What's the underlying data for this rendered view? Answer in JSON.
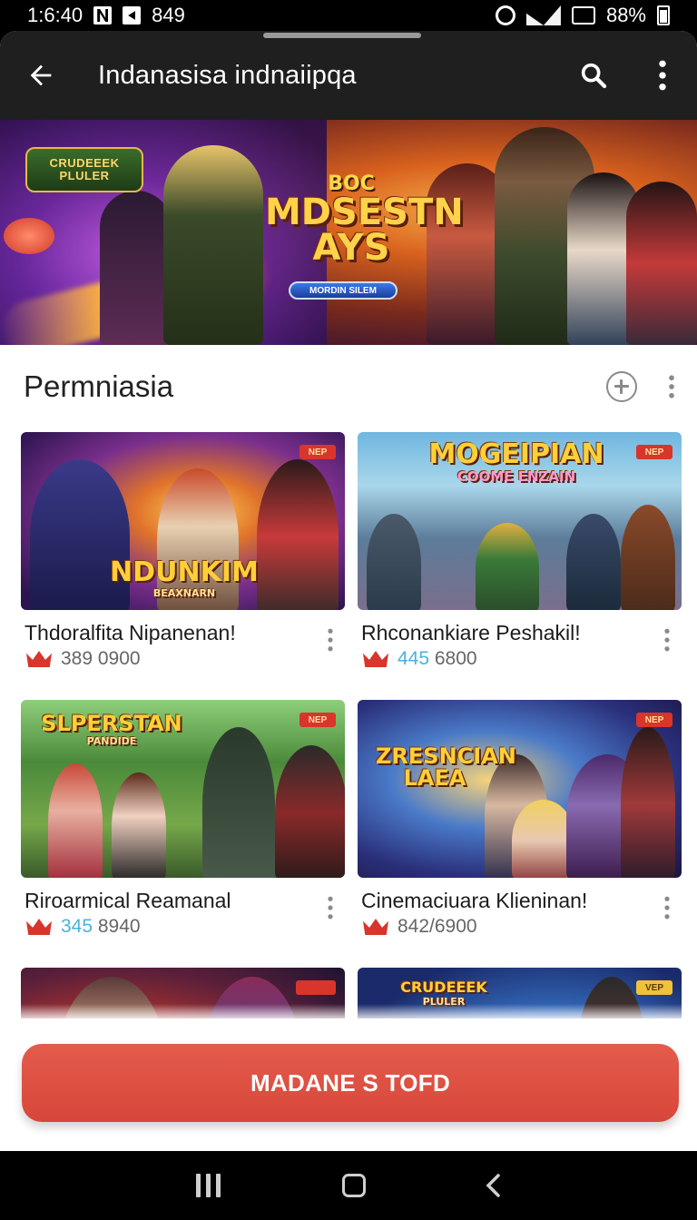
{
  "status_bar": {
    "time": "1:6:40",
    "notification_count": "849",
    "battery": "88%",
    "icons": [
      "n-icon",
      "box-icon",
      "alarm-icon",
      "wifi-icon",
      "battery-saver-icon",
      "battery-icon"
    ]
  },
  "app_bar": {
    "title": "Indanasisa indnaiipqa",
    "back_icon": "arrow-left-icon",
    "search_icon": "search-icon",
    "more_icon": "more-vertical-icon"
  },
  "banner": {
    "logo_line1": "CRUDEEEK",
    "logo_line2": "PLULER",
    "supertitle": "BOC",
    "title": "MDSESTN\nAYS",
    "pill": "MORDIN SILEM"
  },
  "section": {
    "title": "Permniasia",
    "add_icon": "plus-circle-icon",
    "more_icon": "more-vertical-icon"
  },
  "games": [
    {
      "title": "Thdoralfita Nipanenan!",
      "count": "389 0900",
      "count_prefix": "",
      "logo": "NDUNKIM",
      "logo_sub": "BEAXNARN",
      "badge": "NEP"
    },
    {
      "title": "Rhconankiare Peshakil!",
      "count": " 6800",
      "count_prefix": "445",
      "logo": "MOGEIPIAN",
      "logo_sub": "COOME ENZAIN",
      "badge": "NEP"
    },
    {
      "title": "Riroarmical Reamanal",
      "count": " 8940",
      "count_prefix": "345",
      "logo": "SLPERSTAN",
      "logo_sub": "PANDIDE",
      "badge": "NEP"
    },
    {
      "title": "Cinemaciuara Klieninan!",
      "count": "842/6900",
      "count_prefix": "",
      "logo": "ZRESNCIAN LAEA",
      "logo_sub": "",
      "badge": "NEP"
    },
    {
      "title": "",
      "count": "",
      "count_prefix": "",
      "logo": "",
      "logo_sub": "",
      "badge": ""
    },
    {
      "title": "",
      "count": "",
      "count_prefix": "",
      "logo": "CRUDEEEK",
      "logo_sub": "PLULER",
      "badge": "VEP"
    }
  ],
  "cta": {
    "label": "MADANE S TOFD"
  },
  "nav_bar": {
    "icons": [
      "recent-apps-icon",
      "home-icon",
      "back-icon"
    ]
  },
  "colors": {
    "accent": "#d8463a",
    "app_bar": "#1f1f1f",
    "count_accent": "#4ab3d8"
  }
}
